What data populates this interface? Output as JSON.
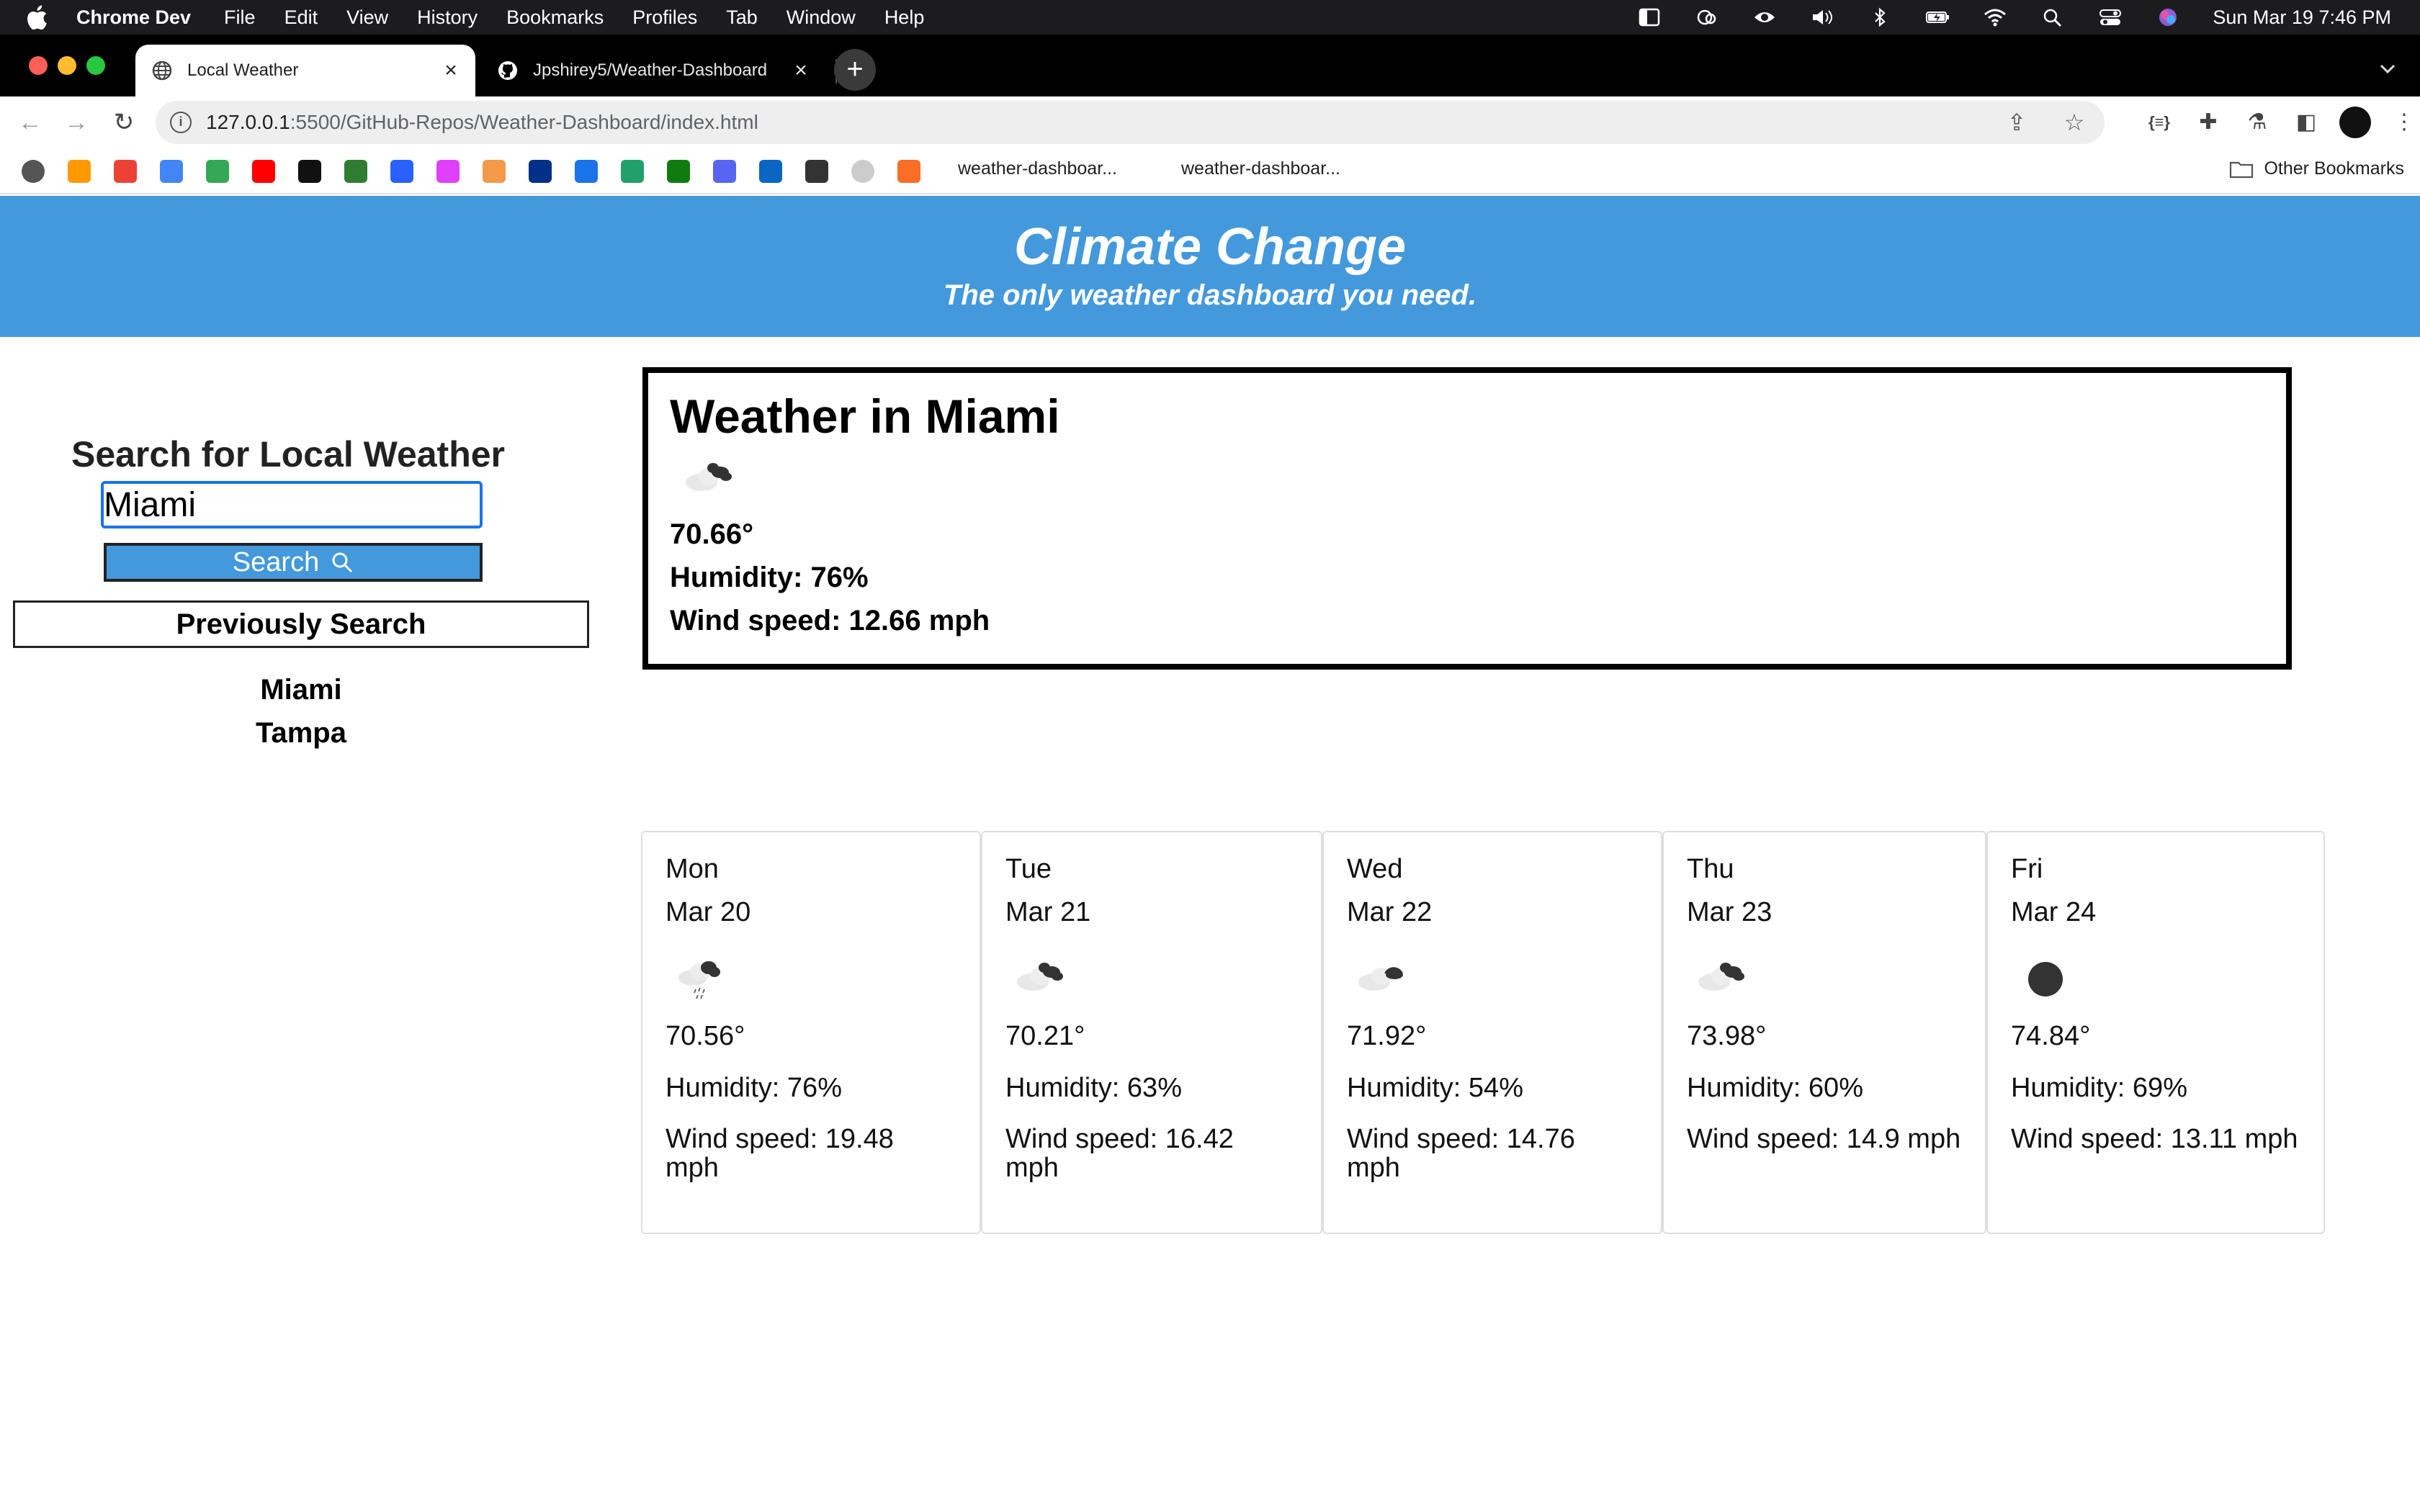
{
  "menubar": {
    "app_name": "Chrome Dev",
    "items": [
      "File",
      "Edit",
      "View",
      "History",
      "Bookmarks",
      "Profiles",
      "Tab",
      "Window",
      "Help"
    ],
    "clock": "Sun Mar 19  7:46 PM"
  },
  "tabs": [
    {
      "title": "Local Weather",
      "icon": "globe-icon",
      "active": true
    },
    {
      "title": "Jpshirey5/Weather-Dashboard",
      "icon": "github-icon",
      "active": false
    }
  ],
  "address_bar": {
    "host": "127.0.0.1",
    "path": ":5500/GitHub-Repos/Weather-Dashboard/index.html"
  },
  "bookmarks": {
    "links": [
      "weather-dashboar...",
      "weather-dashboar..."
    ],
    "other": "Other Bookmarks",
    "icon_colors": [
      "#555555",
      "#ff9900",
      "#ea4335",
      "#4285f4",
      "#34a853",
      "#ff0000",
      "#111111",
      "#2e7d32",
      "#2962ff",
      "#e040fb",
      "#f2994a",
      "#003087",
      "#1a73e8",
      "#22a06b",
      "#107c10",
      "#5865f2",
      "#0a66c2",
      "#333333",
      "#cccccc",
      "#fc6d26"
    ]
  },
  "hero": {
    "title": "Climate Change",
    "subtitle": "The only weather dashboard you need.",
    "background": "#4399dc"
  },
  "search": {
    "heading": "Search for Local Weather",
    "input_value": "Miami",
    "button_label": "Search",
    "previous_heading": "Previously Search",
    "history": [
      "Miami",
      "Tampa"
    ]
  },
  "current": {
    "title": "Weather in Miami",
    "icon": "broken-clouds-icon",
    "temp": "70.66°",
    "humidity": "Humidity: 76%",
    "wind": "Wind speed: 12.66 mph"
  },
  "forecast": [
    {
      "day": "Mon",
      "date": "Mar 20",
      "icon": "rain-cloud-icon",
      "temp": "70.56°",
      "humidity": "Humidity: 76%",
      "wind": "Wind speed: 19.48 mph"
    },
    {
      "day": "Tue",
      "date": "Mar 21",
      "icon": "broken-clouds-icon",
      "temp": "70.21°",
      "humidity": "Humidity: 63%",
      "wind": "Wind speed: 16.42 mph"
    },
    {
      "day": "Wed",
      "date": "Mar 22",
      "icon": "scattered-clouds-icon",
      "temp": "71.92°",
      "humidity": "Humidity: 54%",
      "wind": "Wind speed: 14.76 mph"
    },
    {
      "day": "Thu",
      "date": "Mar 23",
      "icon": "broken-clouds-icon",
      "temp": "73.98°",
      "humidity": "Humidity: 60%",
      "wind": "Wind speed: 14.9 mph"
    },
    {
      "day": "Fri",
      "date": "Mar 24",
      "icon": "clear-sky-icon",
      "temp": "74.84°",
      "humidity": "Humidity: 69%",
      "wind": "Wind speed: 13.11 mph"
    }
  ]
}
